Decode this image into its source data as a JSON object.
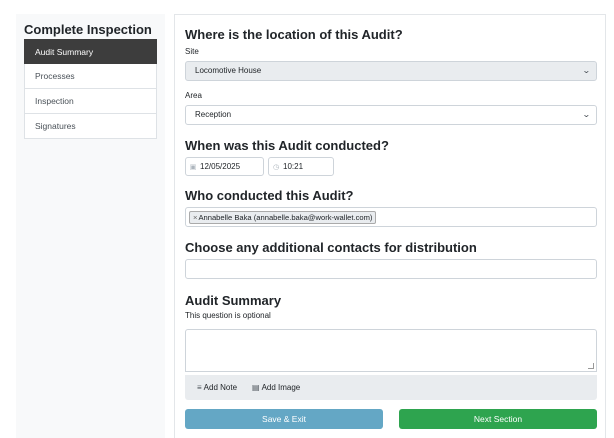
{
  "sidebar": {
    "title": "Complete Inspection",
    "items": [
      {
        "label": "Audit Summary",
        "active": true
      },
      {
        "label": "Processes"
      },
      {
        "label": "Inspection"
      },
      {
        "label": "Signatures"
      }
    ]
  },
  "location": {
    "heading": "Where is the location of this Audit?",
    "site_label": "Site",
    "site_value": "Locomotive House",
    "area_label": "Area",
    "area_value": "Reception"
  },
  "conducted": {
    "heading": "When was this Audit conducted?",
    "date": "12/05/2025",
    "time": "10:21"
  },
  "conductor": {
    "heading": "Who conducted this Audit?",
    "tag_remove": "×",
    "tag": "Annabelle Baka (annabelle.baka@work-wallet.com)"
  },
  "contacts": {
    "heading": "Choose any additional contacts for distribution",
    "value": ""
  },
  "summary": {
    "heading": "Audit Summary",
    "hint": "This question is optional",
    "value": "",
    "add_note": "Add Note",
    "add_image": "Add Image"
  },
  "actions": {
    "save_exit": "Save & Exit",
    "next_section": "Next Section"
  },
  "colors": {
    "active_nav": "#3d3d3d",
    "save_button": "#64a7c5",
    "next_button": "#2ea44f"
  }
}
